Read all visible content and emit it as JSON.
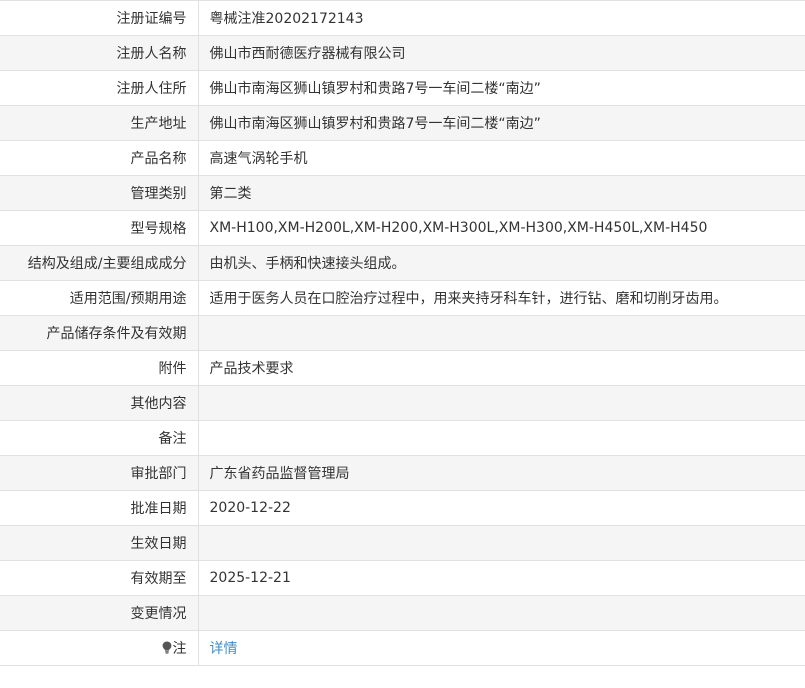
{
  "rows": [
    {
      "label": "注册证编号",
      "value": "粤械注准20202172143"
    },
    {
      "label": "注册人名称",
      "value": "佛山市西耐德医疗器械有限公司"
    },
    {
      "label": "注册人住所",
      "value": "佛山市南海区狮山镇罗村和贵路7号一车间二楼“南边”"
    },
    {
      "label": "生产地址",
      "value": "佛山市南海区狮山镇罗村和贵路7号一车间二楼“南边”"
    },
    {
      "label": "产品名称",
      "value": "高速气涡轮手机"
    },
    {
      "label": "管理类别",
      "value": "第二类"
    },
    {
      "label": "型号规格",
      "value": "XM-H100,XM-H200L,XM-H200,XM-H300L,XM-H300,XM-H450L,XM-H450"
    },
    {
      "label": "结构及组成/主要组成成分",
      "value": "由机头、手柄和快速接头组成。"
    },
    {
      "label": "适用范围/预期用途",
      "value": "适用于医务人员在口腔治疗过程中，用来夹持牙科车针，进行钻、磨和切削牙齿用。"
    },
    {
      "label": "产品储存条件及有效期",
      "value": ""
    },
    {
      "label": "附件",
      "value": "产品技术要求"
    },
    {
      "label": "其他内容",
      "value": ""
    },
    {
      "label": "备注",
      "value": ""
    },
    {
      "label": "审批部门",
      "value": "广东省药品监督管理局"
    },
    {
      "label": "批准日期",
      "value": "2020-12-22"
    },
    {
      "label": "生效日期",
      "value": ""
    },
    {
      "label": "有效期至",
      "value": "2025-12-21"
    },
    {
      "label": "变更情况",
      "value": ""
    }
  ],
  "note_row": {
    "icon": "lightbulb-icon",
    "label": "注",
    "link_text": "详情",
    "link_color": "#3a8fd0"
  },
  "colors": {
    "alt_row_bg": "#f5f5f5",
    "border": "#e1e1e1",
    "text": "#333333"
  }
}
